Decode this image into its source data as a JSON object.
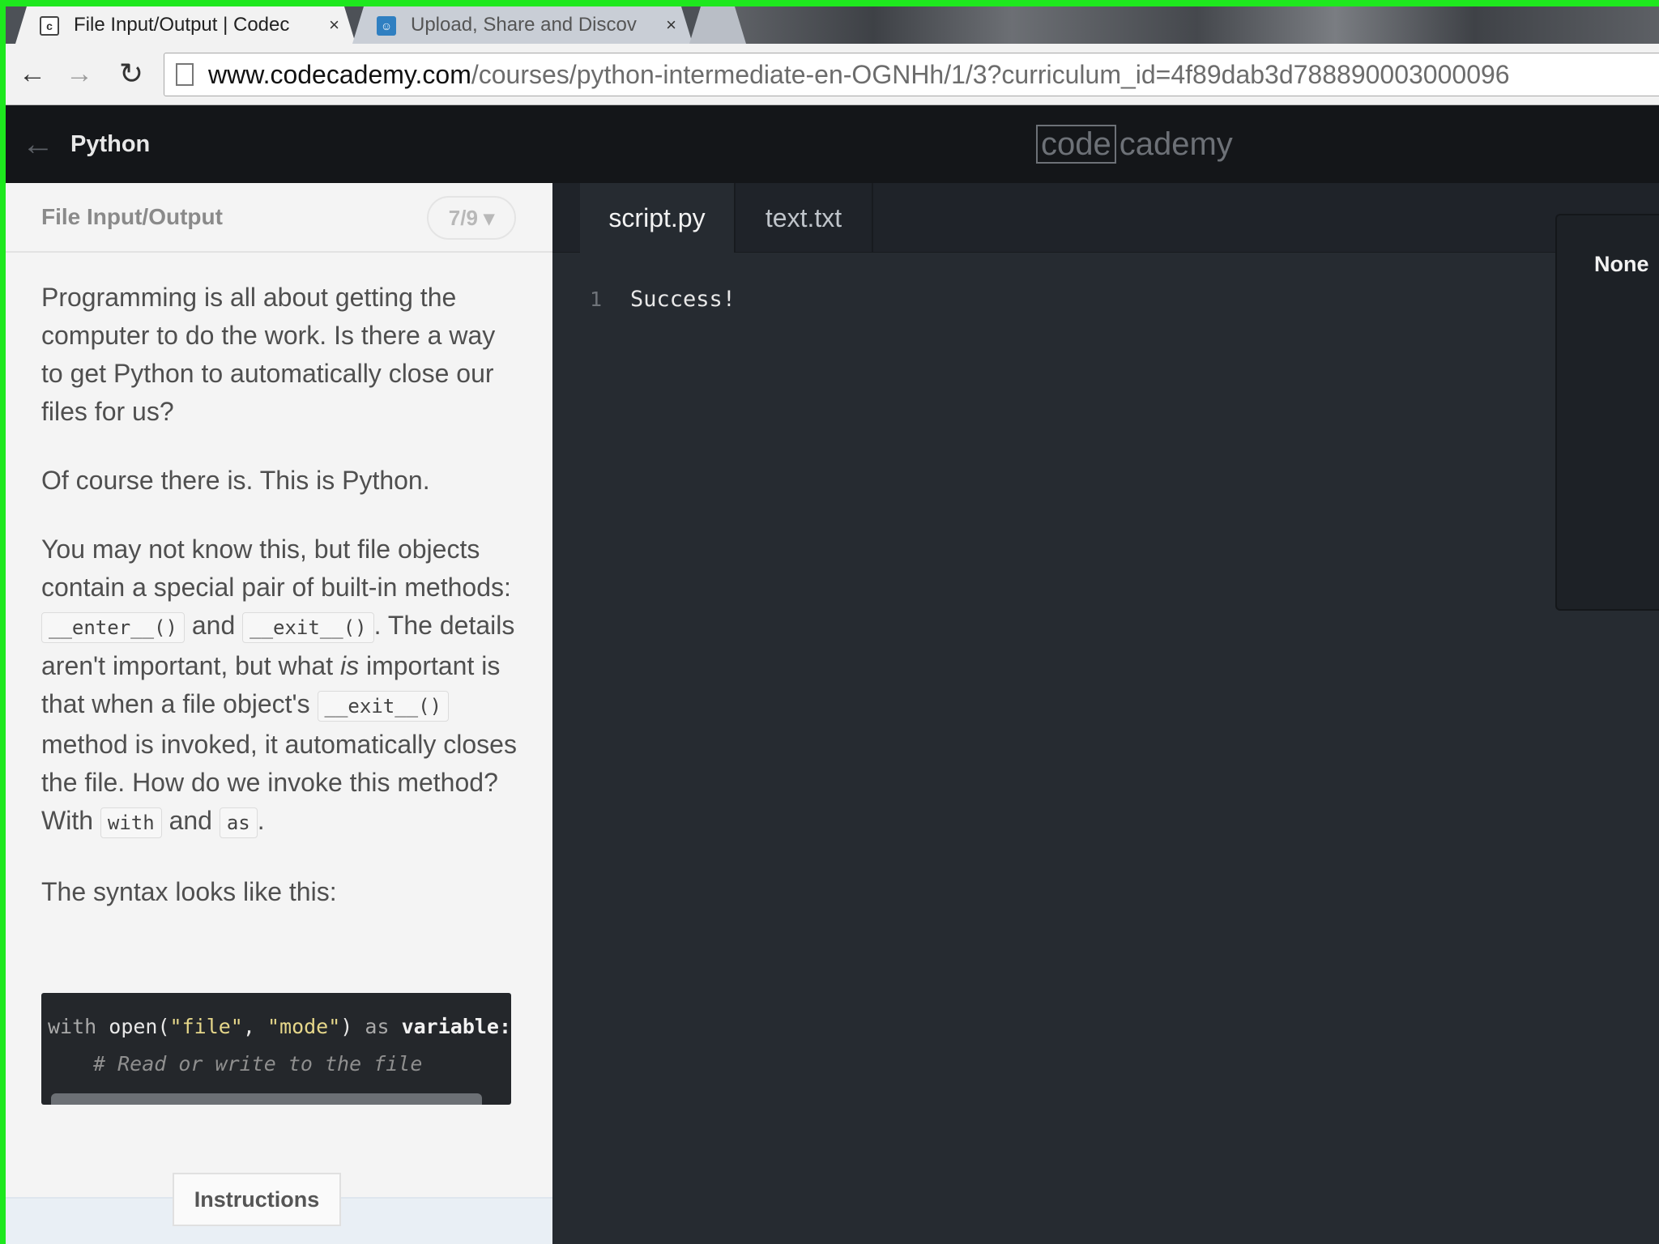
{
  "browser": {
    "tabs": [
      {
        "title": "File Input/Output | Codec",
        "favicon": "codecademy-favicon",
        "favicon_glyph": "c",
        "active": true
      },
      {
        "title": "Upload, Share and Discov",
        "favicon": "upload-site-favicon",
        "favicon_glyph": "☺",
        "active": false
      }
    ],
    "close_glyph": "×",
    "nav": {
      "back": "←",
      "forward": "→",
      "reload": "↻"
    },
    "url": {
      "domain": "www.codecademy.com",
      "path": "/courses/python-intermediate-en-OGNHh/1/3?curriculum_id=4f89dab3d788890003000096"
    }
  },
  "header": {
    "back_arrow": "←",
    "course_title": "Python",
    "logo": {
      "boxed": "code",
      "rest": "cademy"
    }
  },
  "lesson": {
    "title": "File Input/Output",
    "progress": "7/9 ▾",
    "p1": "Programming is all about getting the computer to do the work. Is there a way to get Python to automatically close our files for us?",
    "p2": "Of course there is. This is Python.",
    "p3": {
      "t1": "You may not know this, but file objects contain a special pair of built-in methods: ",
      "c1": "__enter__()",
      "t2": " and ",
      "c2": "__exit__()",
      "t3": ". The details aren't important, but what ",
      "em": "is",
      "t4": " important is that when a file object's ",
      "c3": "__exit__()",
      "t5": " method is invoked, it automatically closes the file. How do we invoke this method? With ",
      "c4": "with",
      "t6": " and ",
      "c5": "as",
      "t7": "."
    },
    "p4": "The syntax looks like this:",
    "code": {
      "kw_with": "with",
      "fn_open": "open(",
      "str_file": "\"file\"",
      "comma": ", ",
      "str_mode": "\"mode\"",
      "paren": ")",
      "kw_as": "as",
      "var": "variable:",
      "comment": "# Read or write to the file"
    },
    "instructions_tab": "Instructions"
  },
  "editor": {
    "tabs": [
      {
        "label": "script.py",
        "active": true
      },
      {
        "label": "text.txt",
        "active": false
      }
    ],
    "line_number": "1",
    "line_text": "Success!",
    "output": "None"
  },
  "colors": {
    "frame": "#1ee81e",
    "header_bg": "#141619",
    "editor_bg": "#262b31",
    "lesson_bg": "#f4f4f4"
  }
}
